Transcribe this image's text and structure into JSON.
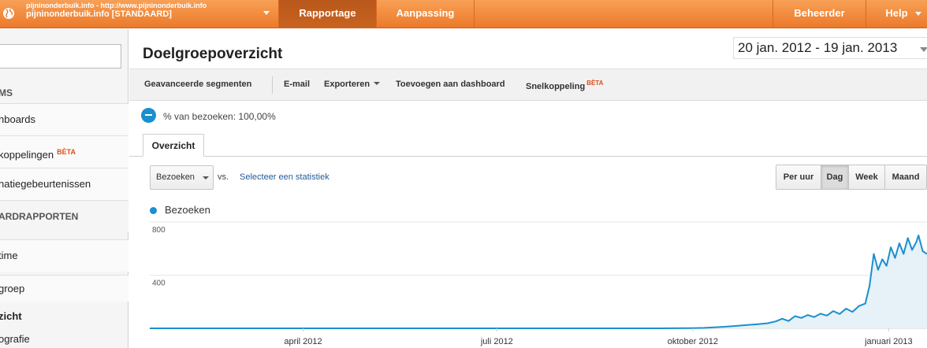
{
  "topbar": {
    "account_line1": "pijninonderbuik.info - http://www.pijninonderbuik.info",
    "account_line2": "pijninonderbuik.info [STANDAARD]",
    "tabs": [
      "Rapportage",
      "Aanpassing"
    ],
    "right_tabs": [
      "Beheerder",
      "Help"
    ],
    "accent": "#ec7a2a"
  },
  "sidebar": {
    "items": [
      {
        "label": "MS"
      },
      {
        "label": "hboards"
      },
      {
        "label": "koppelingen",
        "badge": "BÈTA"
      },
      {
        "label": "natiegebeurtenissen"
      },
      {
        "label": "ARDRAPPORTEN"
      },
      {
        "label": "time"
      },
      {
        "label": "groep"
      },
      {
        "label": "zicht"
      },
      {
        "label": "ografie"
      }
    ]
  },
  "main": {
    "title": "Doelgroepoverzicht",
    "date_range": "20 jan. 2012 - 19 jan. 2013",
    "toolbar": {
      "advanced_segments": "Geavanceerde segmenten",
      "email": "E-mail",
      "export": "Exporteren",
      "add_dashboard": "Toevoegen aan dashboard",
      "shortcut": "Snelkoppeling",
      "shortcut_badge": "BÈTA"
    },
    "segment": "% van bezoeken: 100,00%",
    "tab": "Overzicht",
    "metric": "Bezoeken",
    "vs": "vs.",
    "select_metric": "Selecteer een statistiek",
    "periods": [
      "Per uur",
      "Dag",
      "Week",
      "Maand"
    ],
    "active_period": "Dag",
    "legend": "Bezoeken"
  },
  "chart_data": {
    "type": "area",
    "series": [
      {
        "name": "Bezoeken",
        "color": "#1a8fcf",
        "points": [
          [
            "2012-01-20",
            0
          ],
          [
            "2012-03-01",
            0
          ],
          [
            "2012-04-01",
            0
          ],
          [
            "2012-05-15",
            0
          ],
          [
            "2012-07-01",
            0
          ],
          [
            "2012-08-15",
            0
          ],
          [
            "2012-09-15",
            0
          ],
          [
            "2012-10-01",
            1
          ],
          [
            "2012-10-06",
            3
          ],
          [
            "2012-10-11",
            8
          ],
          [
            "2012-10-16",
            12
          ],
          [
            "2012-10-21",
            18
          ],
          [
            "2012-10-26",
            24
          ],
          [
            "2012-10-31",
            30
          ],
          [
            "2012-11-05",
            38
          ],
          [
            "2012-11-09",
            52
          ],
          [
            "2012-11-12",
            72
          ],
          [
            "2012-11-15",
            55
          ],
          [
            "2012-11-18",
            92
          ],
          [
            "2012-11-21",
            78
          ],
          [
            "2012-11-24",
            100
          ],
          [
            "2012-11-27",
            85
          ],
          [
            "2012-11-30",
            110
          ],
          [
            "2012-12-03",
            96
          ],
          [
            "2012-12-06",
            130
          ],
          [
            "2012-12-09",
            108
          ],
          [
            "2012-12-12",
            148
          ],
          [
            "2012-12-15",
            124
          ],
          [
            "2012-12-18",
            168
          ],
          [
            "2012-12-21",
            186
          ],
          [
            "2012-12-23",
            320
          ],
          [
            "2012-12-25",
            560
          ],
          [
            "2012-12-27",
            440
          ],
          [
            "2012-12-29",
            520
          ],
          [
            "2012-12-31",
            470
          ],
          [
            "2013-01-02",
            610
          ],
          [
            "2013-01-04",
            530
          ],
          [
            "2013-01-06",
            640
          ],
          [
            "2013-01-08",
            560
          ],
          [
            "2013-01-10",
            680
          ],
          [
            "2013-01-12",
            590
          ],
          [
            "2013-01-14",
            650
          ],
          [
            "2013-01-15",
            700
          ],
          [
            "2013-01-17",
            580
          ],
          [
            "2013-01-19",
            560
          ]
        ]
      }
    ],
    "x_ticks": [
      "april 2012",
      "juli 2012",
      "oktober 2012",
      "januari 2013"
    ],
    "x_tick_dates": [
      "2012-04-01",
      "2012-07-01",
      "2012-10-01",
      "2013-01-01"
    ],
    "xlim": [
      "2012-01-20",
      "2013-01-19"
    ],
    "y_ticks": [
      "800",
      "400"
    ],
    "ylim": [
      0,
      800
    ],
    "grid": true
  }
}
